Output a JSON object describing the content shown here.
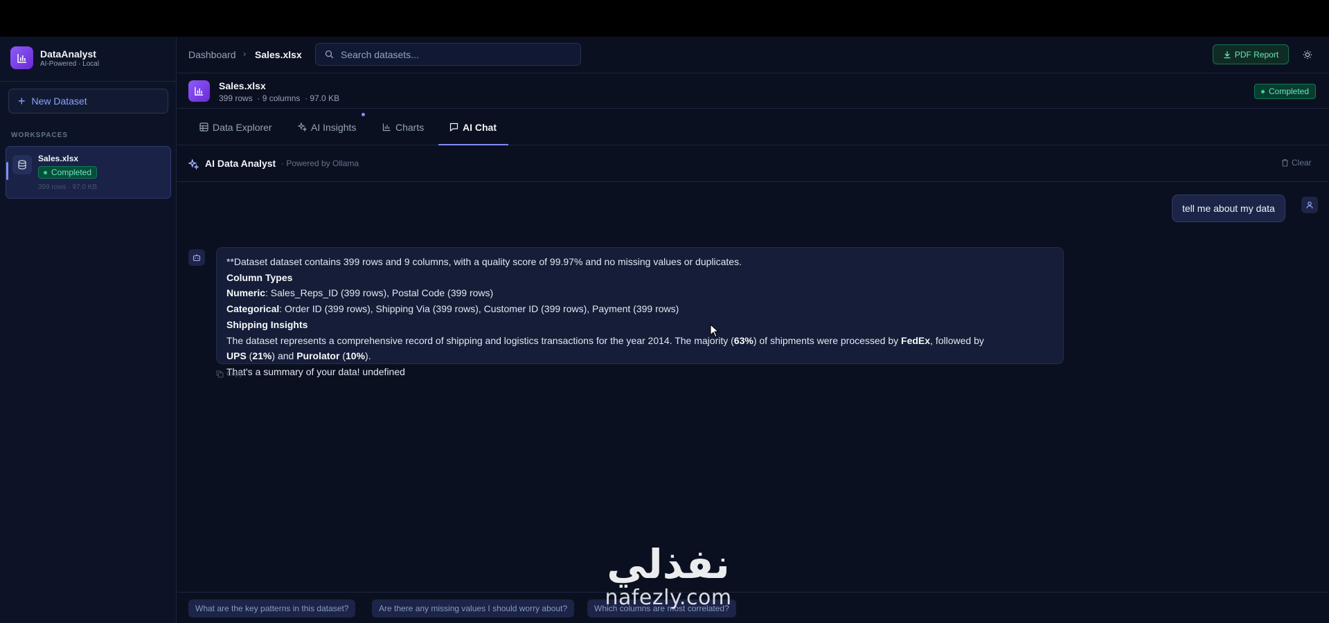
{
  "brand": {
    "name": "DataAnalyst",
    "subtitle": "AI-Powered · Local"
  },
  "sidebar": {
    "new_dataset_label": "New Dataset",
    "workspaces_label": "WORKSPACES",
    "items": [
      {
        "name": "Sales.xlsx",
        "status": "Completed",
        "meta": "399 rows · 97.0 KB"
      }
    ]
  },
  "header": {
    "breadcrumb_root": "Dashboard",
    "breadcrumb_sep": "›",
    "breadcrumb_current": "Sales.xlsx",
    "search_placeholder": "Search datasets...",
    "pdf_button": "PDF Report"
  },
  "file": {
    "name": "Sales.xlsx",
    "meta": "399 rows  · 9 columns  · 97.0 KB",
    "status": "Completed"
  },
  "tabs": [
    {
      "label": "Data Explorer",
      "active": false
    },
    {
      "label": "AI Insights",
      "active": false
    },
    {
      "label": "Charts",
      "active": false
    },
    {
      "label": "AI Chat",
      "active": true
    }
  ],
  "chat": {
    "title": "AI Data Analyst",
    "powered": "· Powered by Ollama",
    "clear_label": "Clear",
    "user_message": "tell me about my data",
    "assistant": {
      "line1": "**Dataset dataset contains 399 rows and 9 columns, with a quality score of 99.97% and no missing values or duplicates.",
      "heading1": "Column Types",
      "numeric_label": "Numeric",
      "numeric_text": ": Sales_Reps_ID (399 rows), Postal Code (399 rows)",
      "categorical_label": "Categorical",
      "categorical_text": ": Order ID (399 rows), Shipping Via (399 rows), Customer ID (399 rows), Payment (399 rows)",
      "heading2": "Shipping Insights",
      "p1_a": "The dataset represents a comprehensive record of shipping and logistics transactions for the year 2014. The majority (",
      "p1_b": "63%",
      "p1_c": ") of shipments were processed by ",
      "p1_d": "FedEx",
      "p1_e": ", followed by",
      "p2_a": "UPS",
      "p2_b": " (",
      "p2_c": "21%",
      "p2_d": ") and ",
      "p2_e": "Purolator",
      "p2_f": " (",
      "p2_g": "10%",
      "p2_h": ").",
      "closing": "That's a summary of your data! undefined"
    },
    "copy_label": "Copy"
  },
  "suggestions": [
    "What are the key patterns in this dataset?",
    "Are there any missing values I should worry about?",
    "Which columns are most correlated?"
  ],
  "watermark": {
    "arabic": "نفذلي",
    "latin": "nafezly.com"
  },
  "colors": {
    "accent": "#818cf8",
    "success": "#34d399",
    "background": "#0b1020"
  }
}
